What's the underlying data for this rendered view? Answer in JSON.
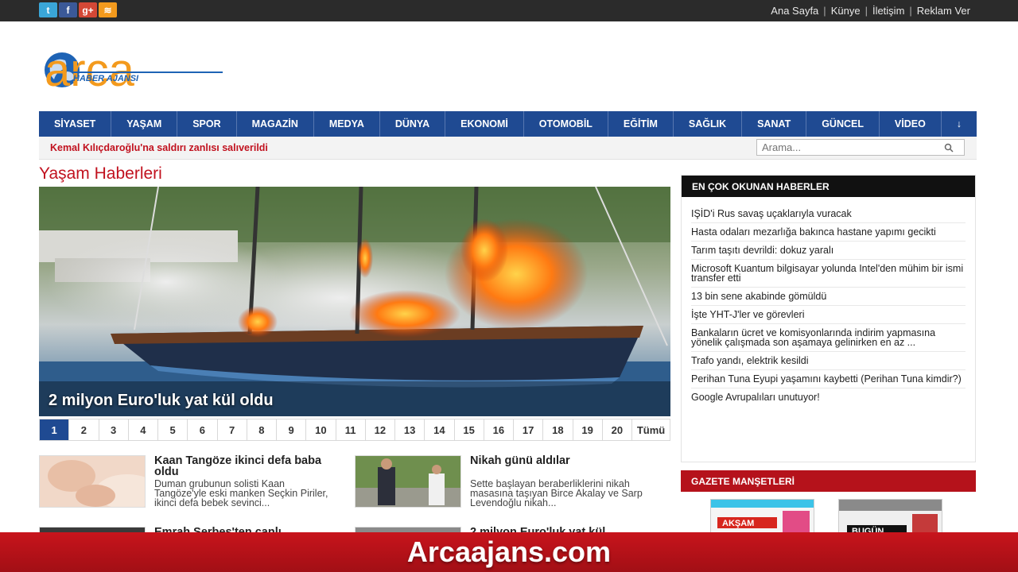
{
  "topbar": {
    "social": [
      {
        "icon": "twitter-icon",
        "glyph": "t"
      },
      {
        "icon": "facebook-icon",
        "glyph": "f"
      },
      {
        "icon": "google-plus-icon",
        "glyph": "g+"
      },
      {
        "icon": "rss-icon",
        "glyph": "≋"
      }
    ],
    "links": [
      "Ana Sayfa",
      "Künye",
      "İletişim",
      "Reklam Ver"
    ],
    "separator": "|"
  },
  "logo": {
    "word": "arca",
    "subtitle": "HABER AJANSI",
    "colors": {
      "orange": "#f39a1d",
      "blue": "#1e63b5"
    }
  },
  "nav": {
    "items": [
      "SİYASET",
      "YAŞAM",
      "SPOR",
      "MAGAZİN",
      "MEDYA",
      "DÜNYA",
      "EKONOMİ",
      "OTOMOBİL",
      "EĞİTİM",
      "SAĞLIK",
      "SANAT",
      "GÜNCEL",
      "VİDEO",
      "↓"
    ]
  },
  "ticker": {
    "text": "Kemal Kılıçdaroğlu'na saldırı zanlısı salıverildi"
  },
  "search": {
    "placeholder": "Arama..."
  },
  "section": {
    "title": "Yaşam Haberleri"
  },
  "hero": {
    "caption": "2 milyon Euro'luk yat kül oldu"
  },
  "pager": {
    "pages": [
      "1",
      "2",
      "3",
      "4",
      "5",
      "6",
      "7",
      "8",
      "9",
      "10",
      "11",
      "12",
      "13",
      "14",
      "15",
      "16",
      "17",
      "18",
      "19",
      "20",
      "Tümü"
    ],
    "active": "1"
  },
  "cards": [
    {
      "title": "Kaan Tangöze ikinci defa baba oldu",
      "desc": "Duman grubunun solisti Kaan Tangöze'yle eski manken Seçkin Piriler, ikinci defa bebek sevinci..."
    },
    {
      "title": "Nikah günü aldılar",
      "desc": "Sette başlayan beraberliklerini nikah masasına taşıyan Birce Akalay ve Sarp Levendoğlu nikah..."
    },
    {
      "title": "Emrah Serbes'ten canlı...",
      "desc": ""
    },
    {
      "title": "2 milyon Euro'luk yat kül...",
      "desc": ""
    }
  ],
  "popular": {
    "title": "EN ÇOK OKUNAN HABERLER",
    "items": [
      "IŞİD'i Rus savaş uçaklarıyla vuracak",
      "Hasta odaları mezarlığa bakınca hastane yapımı gecikti",
      "Tarım taşıtı devrildi: dokuz yaralı",
      "Microsoft Kuantum bilgisayar yolunda Intel'den mühim bir ismi transfer etti",
      "13 bin sene akabinde gömüldü",
      "İşte YHT-J'ler ve görevleri",
      "Bankaların ücret ve komisyonlarında indirim yapmasına yönelik çalışmada son aşamaya gelinirken en az ...",
      "Trafo yandı, elektrik kesildi",
      "Perihan Tuna Eyupi yaşamını kaybetti (Perihan Tuna kimdir?)",
      "Google Avrupalıları unutuyor!"
    ]
  },
  "headlines": {
    "title": "GAZETE MANŞETLERİ",
    "papers": [
      "AKŞAM",
      "BUGÜN"
    ]
  },
  "banner": {
    "text": "Arcaajans.com"
  }
}
